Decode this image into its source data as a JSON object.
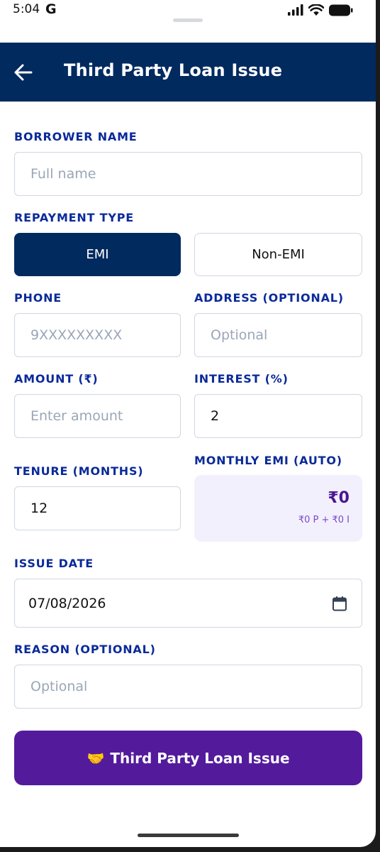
{
  "status_bar": {
    "time": "5:04",
    "g_letter": "G"
  },
  "app_bar": {
    "title": "Third Party Loan Issue"
  },
  "form": {
    "borrower_name": {
      "label": "BORROWER NAME",
      "placeholder": "Full name"
    },
    "repayment_type": {
      "label": "REPAYMENT TYPE",
      "options": [
        "EMI",
        "Non-EMI"
      ],
      "selected": "EMI"
    },
    "phone": {
      "label": "PHONE",
      "placeholder": "9XXXXXXXXX"
    },
    "address": {
      "label": "ADDRESS (OPTIONAL)",
      "placeholder": "Optional"
    },
    "amount": {
      "label": "AMOUNT (₹)",
      "placeholder": "Enter amount"
    },
    "interest": {
      "label": "INTEREST (%)",
      "value": "2"
    },
    "tenure": {
      "label": "TENURE (MONTHS)",
      "value": "12"
    },
    "monthly_emi": {
      "label": "MONTHLY EMI (AUTO)",
      "value": "₹0",
      "breakdown": "₹0 P + ₹0 I"
    },
    "issue_date": {
      "label": "ISSUE DATE",
      "value": "07/08/2026"
    },
    "reason": {
      "label": "REASON (OPTIONAL)",
      "placeholder": "Optional"
    }
  },
  "submit": {
    "emoji": "🤝",
    "label": "Third Party Loan Issue"
  },
  "colors": {
    "appbar": "#012a5f",
    "label": "#0a2a99",
    "submit": "#531b9c",
    "emi_bg": "#f3f0fd"
  }
}
